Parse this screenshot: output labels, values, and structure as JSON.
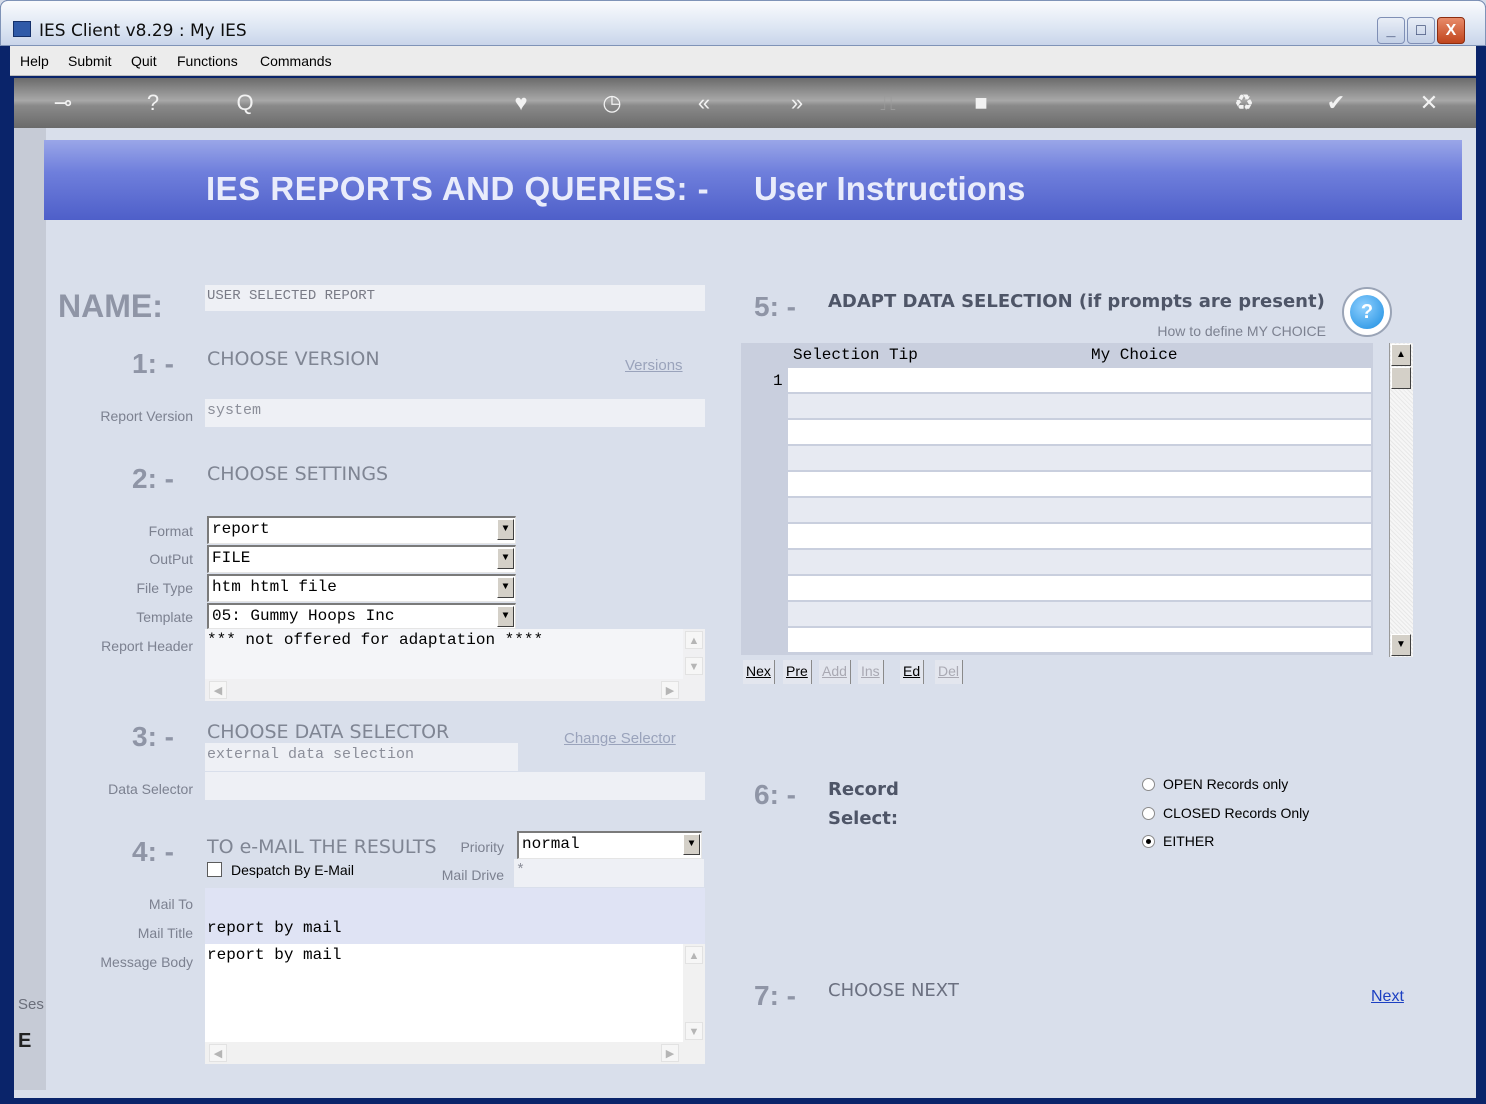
{
  "window": {
    "title": "IES Client v8.29 : My IES",
    "min_label": "_",
    "max_label": "□",
    "close_label": "X"
  },
  "menu": [
    "Help",
    "Submit",
    "Quit",
    "Functions",
    "Commands"
  ],
  "toolbar": {
    "icons": [
      "key-icon",
      "help-icon",
      "search-icon",
      "heart-icon",
      "clock-icon",
      "rewind-icon",
      "forward-icon",
      "document-icon",
      "stop-icon",
      "recycle-icon",
      "check-icon",
      "close-icon"
    ],
    "glyphs": {
      "key": "⊸",
      "help": "?",
      "search": "Q",
      "heart": "♥",
      "clock": "◷",
      "rewind": "«",
      "forward": "»",
      "document": "⎍",
      "stop": "■",
      "recycle": "♻",
      "check": "✔",
      "close": "✕"
    }
  },
  "header": {
    "title": "IES REPORTS AND QUERIES: -",
    "subtitle": "User Instructions"
  },
  "name": {
    "label": "NAME:",
    "value": "USER SELECTED REPORT"
  },
  "step1": {
    "num": "1: -",
    "title": "CHOOSE VERSION",
    "link": "Versions",
    "version_label": "Report Version",
    "version_value": "system"
  },
  "step2": {
    "num": "2: -",
    "title": "CHOOSE SETTINGS",
    "format_label": "Format",
    "format_value": "report",
    "output_label": "OutPut",
    "output_value": "FILE",
    "filetype_label": "File Type",
    "filetype_value": "htm html file",
    "template_label": "Template",
    "template_value": "05: Gummy Hoops Inc",
    "header_label": "Report Header",
    "header_value": "*** not offered for adaptation ****"
  },
  "step3": {
    "num": "3: -",
    "title": "CHOOSE DATA SELECTOR",
    "link": "Change Selector",
    "selector_desc": "external data selection",
    "selector_label": "Data Selector",
    "selector_value": ""
  },
  "step4": {
    "num": "4: -",
    "title": "TO e-MAIL THE RESULTS",
    "priority_label": "Priority",
    "priority_value": "normal",
    "despatch_label": "Despatch By E-Mail",
    "maildrive_label": "Mail Drive",
    "maildrive_value": "*",
    "mailto_label": "Mail To",
    "mailto_value": "",
    "mailtitle_label": "Mail Title",
    "mailtitle_value": "report by mail",
    "body_label": "Message Body",
    "body_value": "report by mail"
  },
  "step5": {
    "num": "5: -",
    "title": "ADAPT DATA SELECTION (if prompts are present)",
    "help_link": "How to define MY CHOICE",
    "col_tip": "Selection Tip",
    "col_choice": "My Choice",
    "row_number": "1",
    "nav": [
      "Nex",
      "Pre",
      "Add",
      "Ins",
      "Ed",
      "Del"
    ]
  },
  "step6": {
    "num": "6: -",
    "title_line1": "Record",
    "title_line2": "Select:",
    "options": [
      "OPEN Records only",
      "CLOSED Records Only",
      "EITHER"
    ],
    "selected": "EITHER"
  },
  "step7": {
    "num": "7: -",
    "title": "CHOOSE NEXT",
    "link": "Next"
  },
  "leftstrip": {
    "text1": "Ses",
    "text2": "E"
  }
}
